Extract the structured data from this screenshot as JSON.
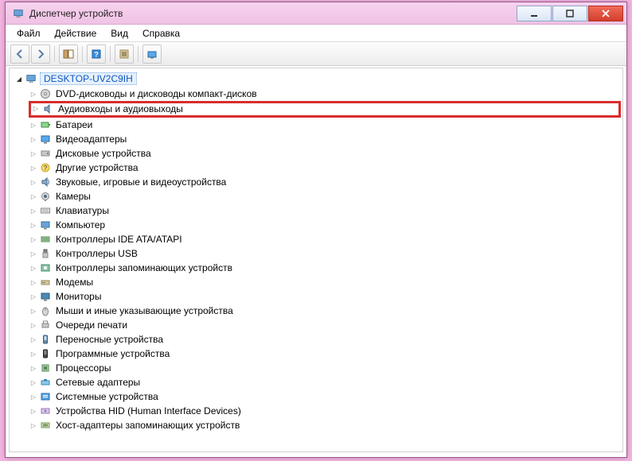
{
  "window": {
    "title": "Диспетчер устройств"
  },
  "menu": {
    "file": "Файл",
    "action": "Действие",
    "view": "Вид",
    "help": "Справка"
  },
  "tree": {
    "root": "DESKTOP-UV2C9IH",
    "children": [
      {
        "label": "DVD-дисководы и дисководы компакт-дисков",
        "icon": "disc"
      },
      {
        "label": "Аудиовходы и аудиовыходы",
        "icon": "audio",
        "highlighted": true
      },
      {
        "label": "Батареи",
        "icon": "battery"
      },
      {
        "label": "Видеоадаптеры",
        "icon": "display"
      },
      {
        "label": "Дисковые устройства",
        "icon": "drive"
      },
      {
        "label": "Другие устройства",
        "icon": "unknown"
      },
      {
        "label": "Звуковые, игровые и видеоустройства",
        "icon": "sound"
      },
      {
        "label": "Камеры",
        "icon": "camera"
      },
      {
        "label": "Клавиатуры",
        "icon": "keyboard"
      },
      {
        "label": "Компьютер",
        "icon": "computer"
      },
      {
        "label": "Контроллеры IDE ATA/ATAPI",
        "icon": "ide"
      },
      {
        "label": "Контроллеры USB",
        "icon": "usb"
      },
      {
        "label": "Контроллеры запоминающих устройств",
        "icon": "storagectrl"
      },
      {
        "label": "Модемы",
        "icon": "modem"
      },
      {
        "label": "Мониторы",
        "icon": "monitor"
      },
      {
        "label": "Мыши и иные указывающие устройства",
        "icon": "mouse"
      },
      {
        "label": "Очереди печати",
        "icon": "printer"
      },
      {
        "label": "Переносные устройства",
        "icon": "portable"
      },
      {
        "label": "Программные устройства",
        "icon": "software"
      },
      {
        "label": "Процессоры",
        "icon": "cpu"
      },
      {
        "label": "Сетевые адаптеры",
        "icon": "network"
      },
      {
        "label": "Системные устройства",
        "icon": "system"
      },
      {
        "label": "Устройства HID (Human Interface Devices)",
        "icon": "hid"
      },
      {
        "label": "Хост-адаптеры запоминающих устройств",
        "icon": "hostadapter"
      }
    ]
  }
}
